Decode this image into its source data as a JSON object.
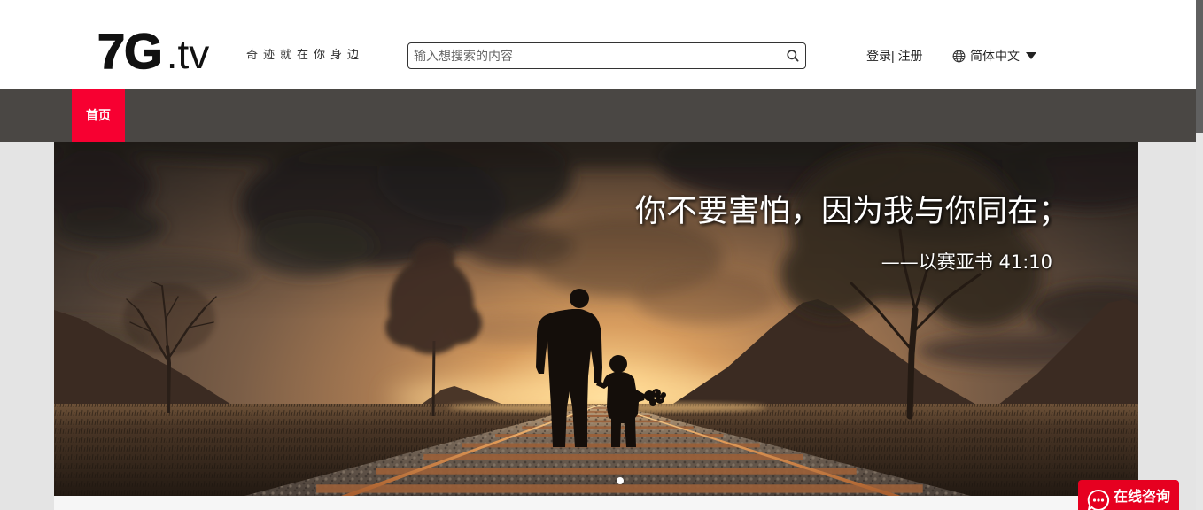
{
  "header": {
    "logo": {
      "main": "7G",
      "suffix": ".tv"
    },
    "tagline": "奇迹就在你身边"
  },
  "search": {
    "placeholder": "输入想搜索的内容",
    "value": "",
    "icon": "search-icon"
  },
  "auth": {
    "login": "登录",
    "separator": "|",
    "register": "注册"
  },
  "language": {
    "selected": "简体中文",
    "icon": "globe-icon",
    "dropdown_icon": "caret-down-icon"
  },
  "nav": {
    "items": [
      {
        "label": "首页",
        "active": true
      }
    ]
  },
  "banner": {
    "quote": "你不要害怕，因为我与你同在；",
    "reference": "——以赛亚书 41:10",
    "carousel": {
      "dot_count": 1,
      "active_index": 0
    }
  },
  "chat": {
    "label": "在线咨询",
    "icon": "chat-bubble-icon"
  },
  "colors": {
    "accent": "#f70031",
    "nav_background": "#4a4744",
    "chat_button": "#e60020",
    "page_background": "#e4e4e4"
  }
}
